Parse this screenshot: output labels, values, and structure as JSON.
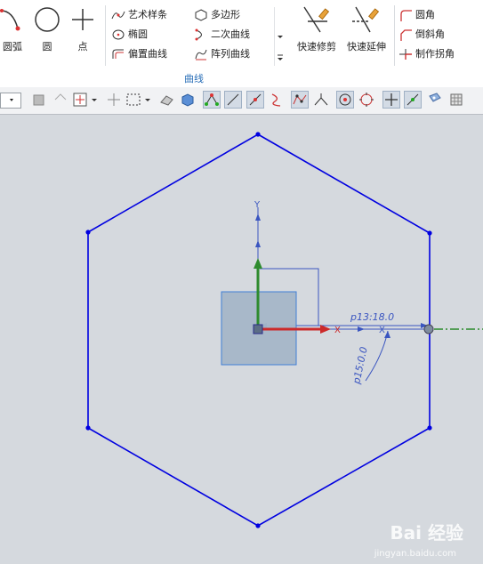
{
  "ribbon": {
    "arc_label": "圆弧",
    "circle_label": "圆",
    "point_label": "点",
    "studio_spline": "艺术样条",
    "ellipse": "椭圆",
    "offset_curve": "偏置曲线",
    "polygon": "多边形",
    "conic": "二次曲线",
    "pattern_curve": "阵列曲线",
    "quick_trim": "快速修剪",
    "quick_extend": "快速延伸",
    "fillet": "圆角",
    "chamfer": "倒斜角",
    "make_corner": "制作拐角",
    "group_label": "曲线"
  },
  "canvas": {
    "dim_p13": "p13:18.0",
    "dim_p15": "p15:0.0",
    "axis_x": "X",
    "axis_y": "Y"
  },
  "watermark": {
    "logo": "Bai 经验",
    "site": "jingyan.baidu.com"
  },
  "colors": {
    "sketch": "#0000e0",
    "dimension": "#3a55c0",
    "x_axis": "#cc2a2a",
    "y_axis": "#2e8b2e",
    "datum": "#2a8a2a",
    "csys_box": "#a6b7c8"
  }
}
